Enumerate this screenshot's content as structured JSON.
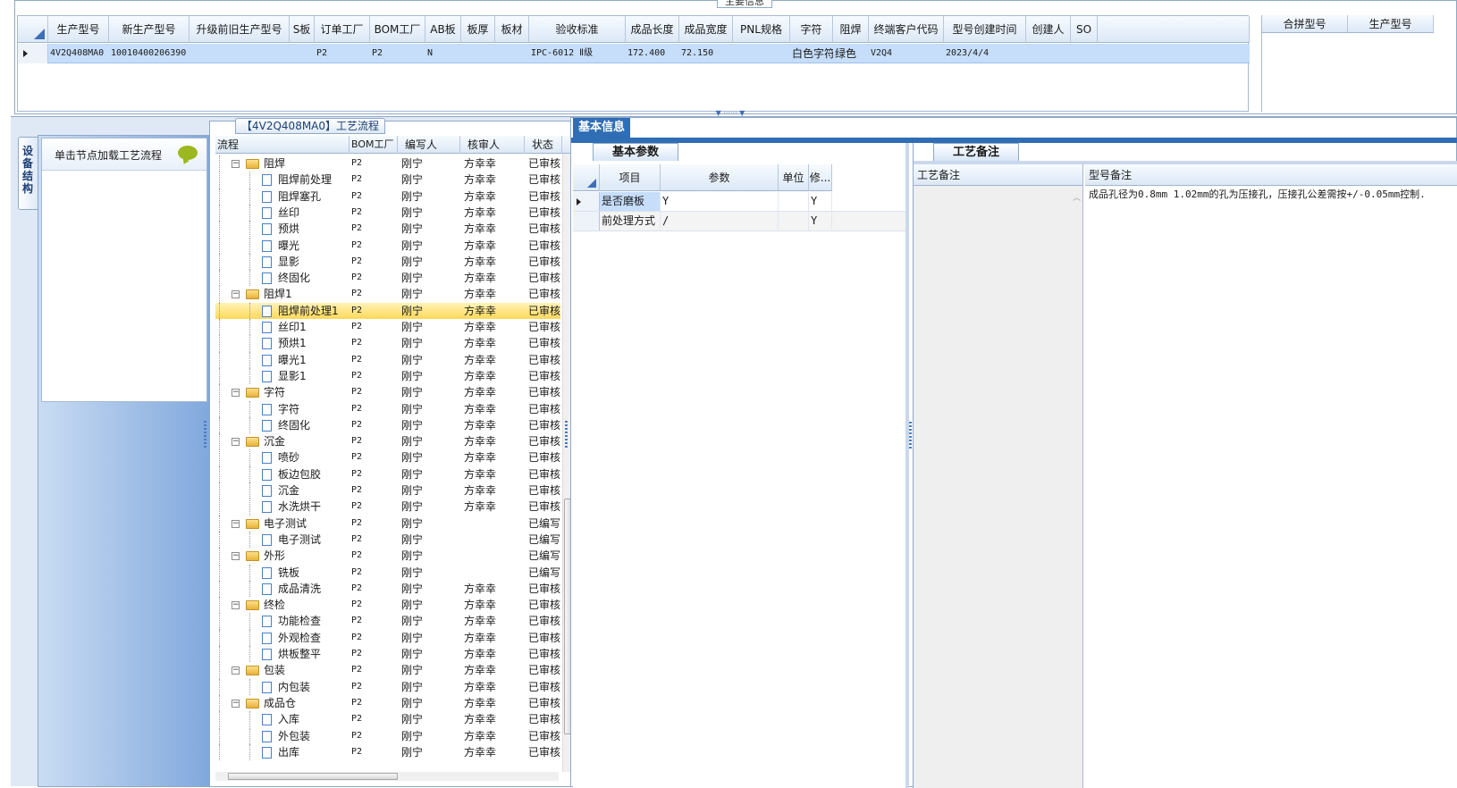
{
  "top": {
    "caption": "主要信息",
    "columns": [
      "生产型号",
      "新生产型号",
      "升级前旧生产型号",
      "S板",
      "订单工厂",
      "BOM工厂",
      "AB板",
      "板厚",
      "板材",
      "验收标准",
      "成品长度",
      "成品宽度",
      "PNL规格",
      "字符",
      "阻焊",
      "终端客户代码",
      "型号创建时间",
      "创建人",
      "SO"
    ],
    "row": [
      "4V2Q408MA0",
      "10010400206390",
      "",
      "",
      "P2",
      "P2",
      "N",
      "",
      "",
      "IPC-6012 Ⅱ级",
      "172.400",
      "72.150",
      "",
      "白色字符",
      "绿色",
      "V2Q4",
      "2023/4/4",
      "",
      ""
    ],
    "right_columns": [
      "合拼型号",
      "生产型号"
    ]
  },
  "side": {
    "tab_label": "设备结构",
    "hint": "单击节点加载工艺流程",
    "bubble_icon": "speech-bubble-icon"
  },
  "process": {
    "caption": "【4V2Q408MA0】工艺流程",
    "columns": [
      "流程",
      "BOM工厂",
      "编写人",
      "核审人",
      "状态"
    ],
    "rows": [
      {
        "name": "阻焊",
        "level": 0,
        "bom": "P2",
        "writer": "刚宁",
        "reviewer": "方幸幸",
        "status": "已审核"
      },
      {
        "name": "阻焊前处理",
        "level": 1,
        "bom": "P2",
        "writer": "刚宁",
        "reviewer": "方幸幸",
        "status": "已审核"
      },
      {
        "name": "阻焊塞孔",
        "level": 1,
        "bom": "P2",
        "writer": "刚宁",
        "reviewer": "方幸幸",
        "status": "已审核"
      },
      {
        "name": "丝印",
        "level": 1,
        "bom": "P2",
        "writer": "刚宁",
        "reviewer": "方幸幸",
        "status": "已审核"
      },
      {
        "name": "预烘",
        "level": 1,
        "bom": "P2",
        "writer": "刚宁",
        "reviewer": "方幸幸",
        "status": "已审核"
      },
      {
        "name": "曝光",
        "level": 1,
        "bom": "P2",
        "writer": "刚宁",
        "reviewer": "方幸幸",
        "status": "已审核"
      },
      {
        "name": "显影",
        "level": 1,
        "bom": "P2",
        "writer": "刚宁",
        "reviewer": "方幸幸",
        "status": "已审核"
      },
      {
        "name": "终固化",
        "level": 1,
        "bom": "P2",
        "writer": "刚宁",
        "reviewer": "方幸幸",
        "status": "已审核"
      },
      {
        "name": "阻焊1",
        "level": 0,
        "bom": "P2",
        "writer": "刚宁",
        "reviewer": "方幸幸",
        "status": "已审核"
      },
      {
        "name": "阻焊前处理1",
        "level": 1,
        "bom": "P2",
        "writer": "刚宁",
        "reviewer": "方幸幸",
        "status": "已审核",
        "selected": true
      },
      {
        "name": "丝印1",
        "level": 1,
        "bom": "P2",
        "writer": "刚宁",
        "reviewer": "方幸幸",
        "status": "已审核"
      },
      {
        "name": "预烘1",
        "level": 1,
        "bom": "P2",
        "writer": "刚宁",
        "reviewer": "方幸幸",
        "status": "已审核"
      },
      {
        "name": "曝光1",
        "level": 1,
        "bom": "P2",
        "writer": "刚宁",
        "reviewer": "方幸幸",
        "status": "已审核"
      },
      {
        "name": "显影1",
        "level": 1,
        "bom": "P2",
        "writer": "刚宁",
        "reviewer": "方幸幸",
        "status": "已审核"
      },
      {
        "name": "字符",
        "level": 0,
        "bom": "P2",
        "writer": "刚宁",
        "reviewer": "方幸幸",
        "status": "已审核"
      },
      {
        "name": "字符",
        "level": 1,
        "bom": "P2",
        "writer": "刚宁",
        "reviewer": "方幸幸",
        "status": "已审核"
      },
      {
        "name": "终固化",
        "level": 1,
        "bom": "P2",
        "writer": "刚宁",
        "reviewer": "方幸幸",
        "status": "已审核"
      },
      {
        "name": "沉金",
        "level": 0,
        "bom": "P2",
        "writer": "刚宁",
        "reviewer": "方幸幸",
        "status": "已审核"
      },
      {
        "name": "喷砂",
        "level": 1,
        "bom": "P2",
        "writer": "刚宁",
        "reviewer": "方幸幸",
        "status": "已审核"
      },
      {
        "name": "板边包胶",
        "level": 1,
        "bom": "P2",
        "writer": "刚宁",
        "reviewer": "方幸幸",
        "status": "已审核"
      },
      {
        "name": "沉金",
        "level": 1,
        "bom": "P2",
        "writer": "刚宁",
        "reviewer": "方幸幸",
        "status": "已审核"
      },
      {
        "name": "水洗烘干",
        "level": 1,
        "bom": "P2",
        "writer": "刚宁",
        "reviewer": "方幸幸",
        "status": "已审核"
      },
      {
        "name": "电子测试",
        "level": 0,
        "bom": "P2",
        "writer": "刚宁",
        "reviewer": "",
        "status": "已编写"
      },
      {
        "name": "电子测试",
        "level": 1,
        "bom": "P2",
        "writer": "刚宁",
        "reviewer": "",
        "status": "已编写"
      },
      {
        "name": "外形",
        "level": 0,
        "bom": "P2",
        "writer": "刚宁",
        "reviewer": "",
        "status": "已编写"
      },
      {
        "name": "铣板",
        "level": 1,
        "bom": "P2",
        "writer": "刚宁",
        "reviewer": "",
        "status": "已编写"
      },
      {
        "name": "成品清洗",
        "level": 1,
        "bom": "P2",
        "writer": "刚宁",
        "reviewer": "方幸幸",
        "status": "已审核"
      },
      {
        "name": "终检",
        "level": 0,
        "bom": "P2",
        "writer": "刚宁",
        "reviewer": "方幸幸",
        "status": "已审核"
      },
      {
        "name": "功能检查",
        "level": 1,
        "bom": "P2",
        "writer": "刚宁",
        "reviewer": "方幸幸",
        "status": "已审核"
      },
      {
        "name": "外观检查",
        "level": 1,
        "bom": "P2",
        "writer": "刚宁",
        "reviewer": "方幸幸",
        "status": "已审核"
      },
      {
        "name": "烘板整平",
        "level": 1,
        "bom": "P2",
        "writer": "刚宁",
        "reviewer": "方幸幸",
        "status": "已审核"
      },
      {
        "name": "包装",
        "level": 0,
        "bom": "P2",
        "writer": "刚宁",
        "reviewer": "方幸幸",
        "status": "已审核"
      },
      {
        "name": "内包装",
        "level": 1,
        "bom": "P2",
        "writer": "刚宁",
        "reviewer": "方幸幸",
        "status": "已审核"
      },
      {
        "name": "成品仓",
        "level": 0,
        "bom": "P2",
        "writer": "刚宁",
        "reviewer": "方幸幸",
        "status": "已审核"
      },
      {
        "name": "入库",
        "level": 1,
        "bom": "P2",
        "writer": "刚宁",
        "reviewer": "方幸幸",
        "status": "已审核"
      },
      {
        "name": "外包装",
        "level": 1,
        "bom": "P2",
        "writer": "刚宁",
        "reviewer": "方幸幸",
        "status": "已审核"
      },
      {
        "name": "出库",
        "level": 1,
        "bom": "P2",
        "writer": "刚宁",
        "reviewer": "方幸幸",
        "status": "已审核"
      }
    ]
  },
  "info": {
    "tab": "基本信息",
    "params_tab": "基本参数",
    "params_columns": [
      "项目",
      "参数",
      "单位",
      "修..."
    ],
    "params_rows": [
      {
        "item": "是否磨板",
        "value": "Y",
        "unit": "",
        "mod": "Y"
      },
      {
        "item": "前处理方式",
        "value": "/",
        "unit": "",
        "mod": "Y"
      }
    ],
    "remarks_tab": "工艺备注",
    "remark_col_left": "工艺备注",
    "remark_col_right": "型号备注",
    "model_remark": "成品孔径为0.8mm 1.02mm的孔为压接孔，压接孔公差需按+/-0.05mm控制."
  }
}
